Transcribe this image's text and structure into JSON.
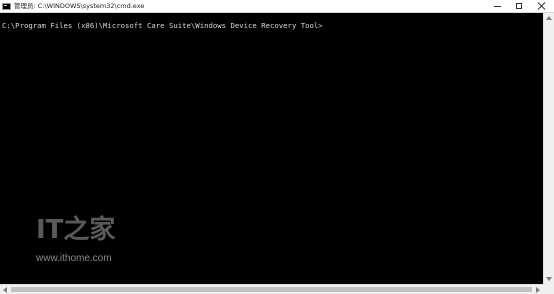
{
  "window": {
    "title": "管理员: C:\\WINDOWS\\system32\\cmd.exe",
    "icon": "console-icon",
    "controls": [
      "minimize-icon",
      "maximize-icon",
      "close-icon"
    ]
  },
  "console": {
    "prompt": "C:\\Program Files (x86)\\Microsoft Care Suite\\Windows Device Recovery Tool>"
  },
  "watermark": {
    "logo": "IT之家",
    "site": "www.ithome.com"
  },
  "colors": {
    "background": "#000000",
    "text": "#d8d8d8",
    "titlebar": "#ffffff",
    "scrollbar": "#f0f0f0"
  }
}
